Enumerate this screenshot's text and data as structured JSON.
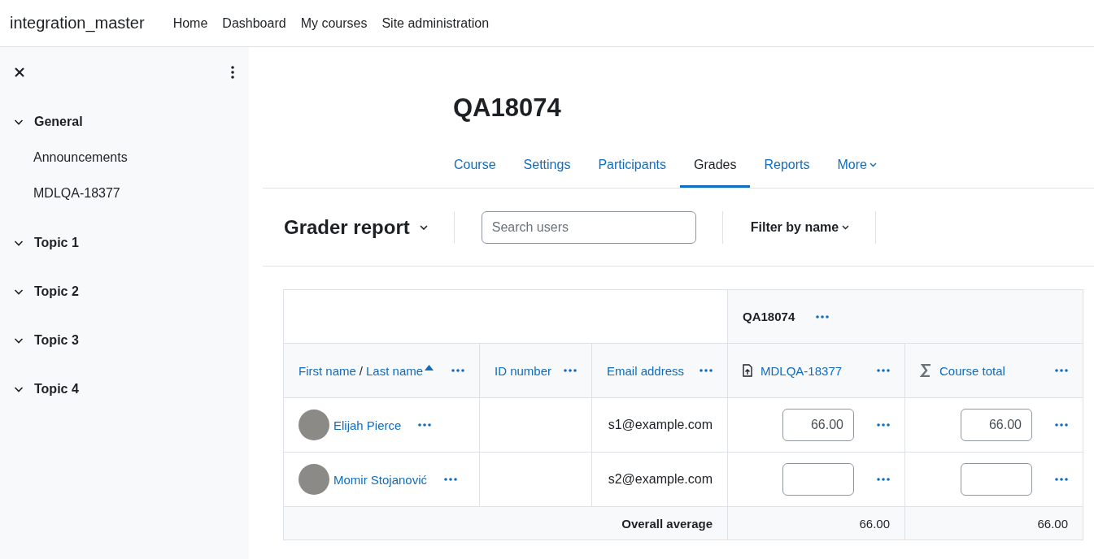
{
  "site_name": "integration_master",
  "nav": [
    "Home",
    "Dashboard",
    "My courses",
    "Site administration"
  ],
  "sidebar": {
    "items": [
      {
        "label": "General",
        "expanded": true,
        "children": [
          {
            "label": "Announcements"
          },
          {
            "label": "MDLQA-18377"
          }
        ]
      },
      {
        "label": "Topic 1",
        "expanded": true
      },
      {
        "label": "Topic 2",
        "expanded": true
      },
      {
        "label": "Topic 3",
        "expanded": true
      },
      {
        "label": "Topic 4",
        "expanded": true
      }
    ]
  },
  "course_title": "QA18074",
  "tabs": [
    {
      "label": "Course",
      "selected": false,
      "kind": "link"
    },
    {
      "label": "Settings",
      "selected": false,
      "kind": "link"
    },
    {
      "label": "Participants",
      "selected": false,
      "kind": "link"
    },
    {
      "label": "Grades",
      "selected": true,
      "kind": "link"
    },
    {
      "label": "Reports",
      "selected": false,
      "kind": "link"
    },
    {
      "label": "More",
      "selected": false,
      "kind": "menu"
    }
  ],
  "toolbar": {
    "report_selector": "Grader report",
    "search": {
      "placeholder": "Search users"
    },
    "filter": "Filter by name"
  },
  "table": {
    "category": "QA18074",
    "columns": [
      {
        "kind": "name",
        "labels": [
          "First name",
          "Last name"
        ],
        "separator": "/",
        "sorted_ascending": true
      },
      {
        "kind": "text",
        "label": "ID number"
      },
      {
        "kind": "text",
        "label": "Email address"
      },
      {
        "kind": "grade_item",
        "label": "MDLQA-18377"
      },
      {
        "kind": "total",
        "label": "Course total"
      }
    ],
    "rows": [
      {
        "name": "Elijah Pierce",
        "email": "s1@example.com",
        "grades": [
          "66.00",
          "66.00"
        ]
      },
      {
        "name": "Momir Stojanović",
        "email": "s2@example.com"
      }
    ],
    "average": {
      "label": "Overall average",
      "values": [
        "66.00",
        "66.00"
      ]
    }
  }
}
